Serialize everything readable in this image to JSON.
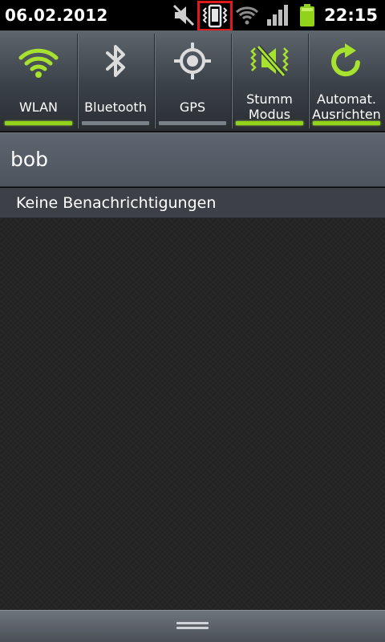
{
  "status_bar": {
    "date": "06.02.2012",
    "time": "22:15",
    "icons": [
      "mute-icon",
      "vibrate-icon",
      "wifi-icon",
      "signal-icon",
      "battery-icon"
    ],
    "highlight_color": "#e0191b"
  },
  "quick_settings": {
    "accent_color": "#93d21b",
    "tiles": [
      {
        "label": "WLAN",
        "icon": "wifi-icon",
        "active": true
      },
      {
        "label": "Bluetooth",
        "icon": "bluetooth-icon",
        "active": false
      },
      {
        "label": "GPS",
        "icon": "gps-icon",
        "active": false
      },
      {
        "label_line1": "Stumm",
        "label_line2": "Modus",
        "icon": "silent-mode-icon",
        "active": true
      },
      {
        "label_line1": "Automat.",
        "label_line2": "Ausrichten",
        "icon": "auto-rotate-icon",
        "active": true
      }
    ]
  },
  "user": {
    "name": "bob"
  },
  "notifications": {
    "header": "Keine Benachrichtigungen"
  }
}
